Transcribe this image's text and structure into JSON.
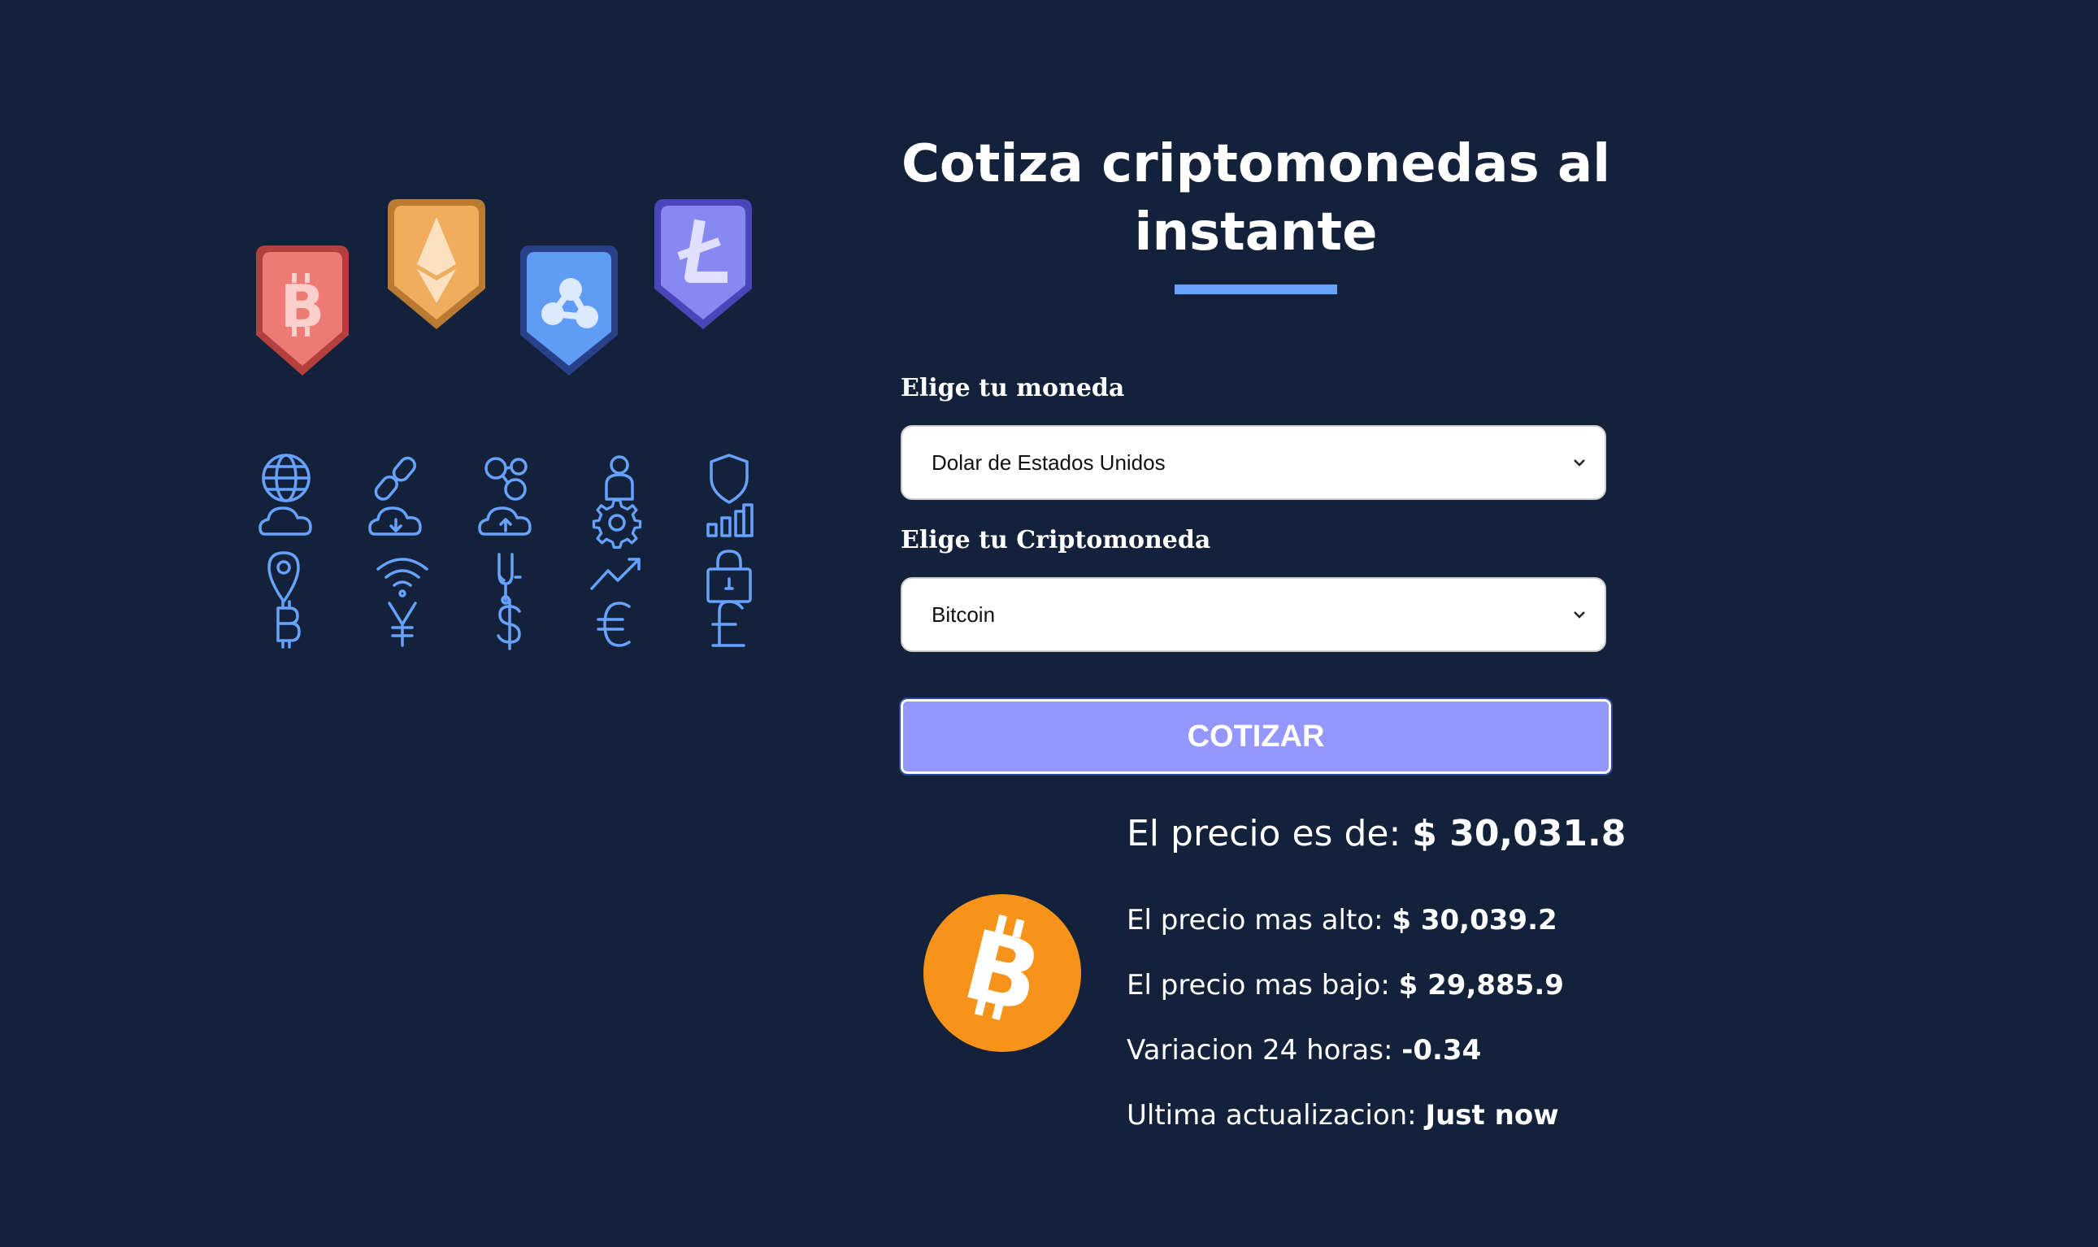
{
  "header": {
    "title": "Cotiza criptomonedas al instante"
  },
  "form": {
    "currency_label": "Elige tu moneda",
    "currency_value": "Dolar de Estados Unidos",
    "crypto_label": "Elige tu Criptomoneda",
    "crypto_value": "Bitcoin",
    "submit_label": "COTIZAR"
  },
  "result": {
    "price_label": "El precio es de:",
    "price_value": "$ 30,031.8",
    "high_label": "El precio mas alto:",
    "high_value": "$ 30,039.2",
    "low_label": "El precio mas bajo:",
    "low_value": "$ 29,885.9",
    "change_label": "Variacion 24 horas:",
    "change_value": "-0.34",
    "updated_label": "Ultima actualizacion:",
    "updated_value": "Just now"
  },
  "illustration": {
    "coin_badges": [
      "bitcoin-icon",
      "ethereum-icon",
      "ripple-icon",
      "litecoin-icon"
    ],
    "icon_grid": [
      "globe-icon",
      "link-icon",
      "network-icon",
      "user-icon",
      "shield-icon",
      "cloud-icon",
      "cloud-download-icon",
      "cloud-upload-icon",
      "gear-icon",
      "bar-chart-icon",
      "location-pin-icon",
      "wifi-icon",
      "fork-icon",
      "trend-up-icon",
      "lock-icon",
      "bitcoin-symbol-icon",
      "yen-icon",
      "dollar-icon",
      "euro-icon",
      "pound-icon"
    ]
  },
  "colors": {
    "background": "#13213a",
    "accent": "#66a2fe",
    "button": "#9497ff",
    "bitcoin": "#f7931a",
    "badge_bitcoin": "#ee7a76",
    "badge_ethereum": "#f0ad5e",
    "badge_ripple": "#5f9cf5",
    "badge_litecoin": "#8888f2"
  }
}
